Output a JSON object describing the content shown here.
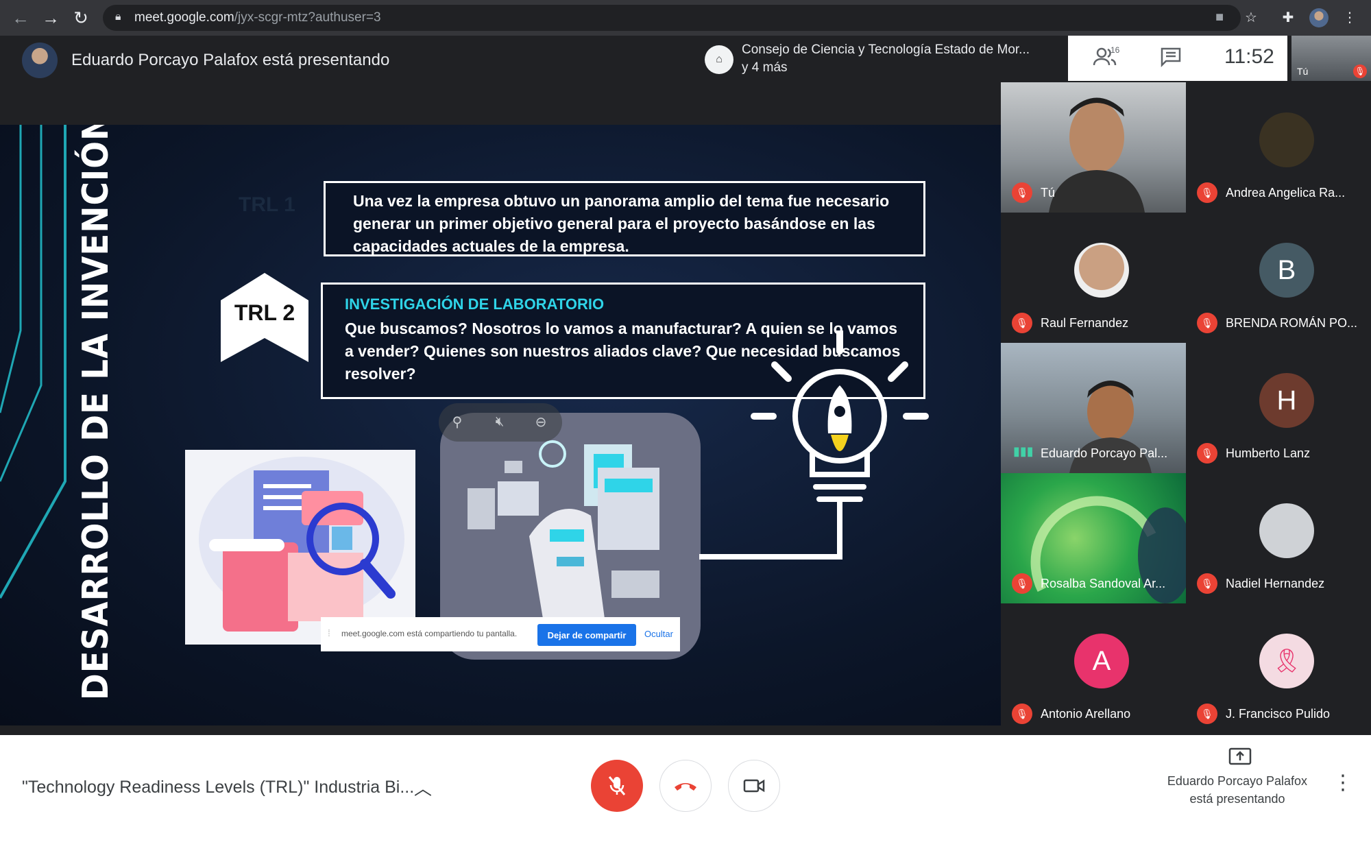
{
  "browser": {
    "url_host": "meet.google.com",
    "url_path": "/jyx-scgr-mtz?authuser=3"
  },
  "header": {
    "presenter_label": "Eduardo Porcayo Palafox está presentando",
    "meeting_name": "Consejo de Ciencia y Tecnología Estado de Mor...",
    "meeting_more": "y 4 más",
    "people_count": "16",
    "clock": "11:52",
    "self_label": "Tú"
  },
  "slide": {
    "side_title": "DESARROLLO DE LA INVENCIÓN",
    "ghost_label": "TRL 1",
    "box1_text": "Una vez la empresa obtuvo un panorama amplio del tema fue necesario generar un primer objetivo general para el proyecto basándose en las capacidades actuales de la empresa.",
    "badge": "TRL 2",
    "box2_heading": "INVESTIGACIÓN DE LABORATORIO",
    "box2_text": "Que buscamos? Nosotros lo vamos a manufacturar? A quien se lo vamos a vender? Quienes son nuestros aliados clave? Que necesidad buscamos resolver?"
  },
  "share_notice": {
    "text": "meet.google.com está compartiendo tu pantalla.",
    "stop": "Dejar de compartir",
    "hide": "Ocultar"
  },
  "participants": [
    {
      "name": "Tú",
      "type": "video",
      "muted": true
    },
    {
      "name": "Andrea Angelica Ra...",
      "type": "photo",
      "muted": true,
      "color": "#3a3222"
    },
    {
      "name": "Raul Fernandez",
      "type": "photo",
      "muted": true,
      "color": "#caa082"
    },
    {
      "name": "BRENDA ROMÁN PO...",
      "type": "initial",
      "initial": "B",
      "muted": true,
      "color": "#455a64"
    },
    {
      "name": "Eduardo Porcayo Pal...",
      "type": "video",
      "muted": false,
      "speaking": true
    },
    {
      "name": "Humberto Lanz",
      "type": "initial",
      "initial": "H",
      "muted": true,
      "color": "#6d3b2e"
    },
    {
      "name": "Rosalba Sandoval Ar...",
      "type": "video",
      "muted": true
    },
    {
      "name": "Nadiel Hernandez",
      "type": "photo",
      "muted": true,
      "color": "#cfd2d6"
    },
    {
      "name": "Antonio Arellano",
      "type": "initial",
      "initial": "A",
      "muted": true,
      "color": "#e8336c"
    },
    {
      "name": "J. Francisco Pulido",
      "type": "photo",
      "muted": true,
      "color": "#f4dbe2"
    }
  ],
  "footer": {
    "meeting_title": "\"Technology Readiness Levels (TRL)\" Industria Bi...",
    "present_label_line1": "Eduardo Porcayo Palafox",
    "present_label_line2": "está presentando"
  },
  "colors": {
    "accent_red": "#ea4335",
    "accent_blue": "#1a73e8",
    "cyan_heading": "#2fd4e8"
  }
}
